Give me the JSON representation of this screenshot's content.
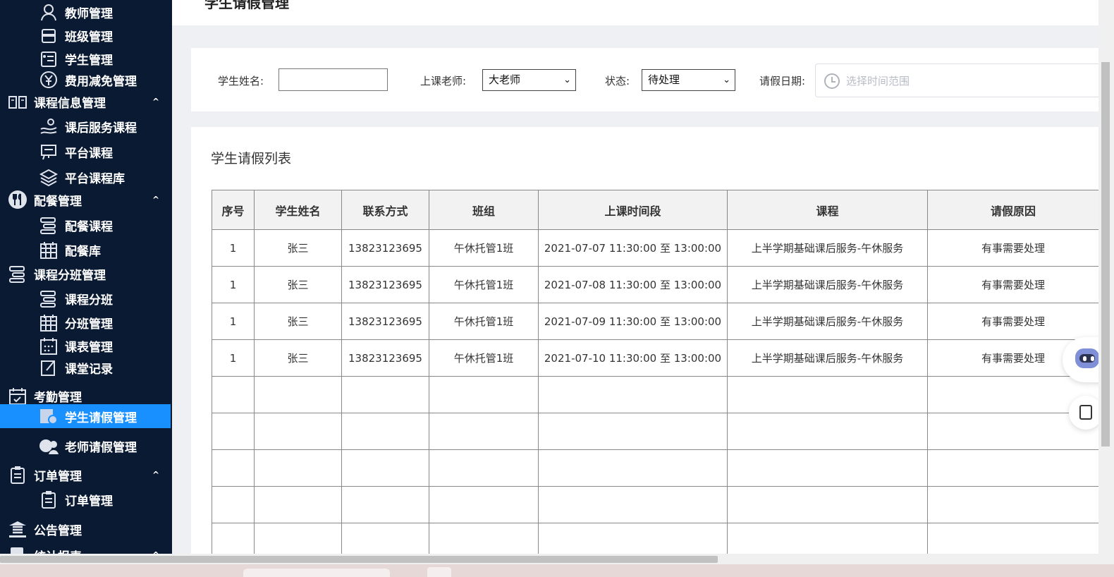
{
  "sidebar": {
    "items": [
      {
        "label": "教师管理",
        "icon": "teacher-icon",
        "level": 2
      },
      {
        "label": "班级管理",
        "icon": "class-icon",
        "level": 2
      },
      {
        "label": "学生管理",
        "icon": "student-card-icon",
        "level": 2
      },
      {
        "label": "费用减免管理",
        "icon": "yen-icon",
        "level": 2
      },
      {
        "label": "课程信息管理",
        "icon": "book-icon",
        "level": 1,
        "expanded": true
      },
      {
        "label": "课后服务课程",
        "icon": "service-icon",
        "level": 2
      },
      {
        "label": "平台课程",
        "icon": "presentation-icon",
        "level": 2
      },
      {
        "label": "平台课程库",
        "icon": "layers-icon",
        "level": 2
      },
      {
        "label": "配餐管理",
        "icon": "fork-knife-icon",
        "level": 1,
        "expanded": true
      },
      {
        "label": "配餐课程",
        "icon": "structure-icon",
        "level": 2
      },
      {
        "label": "配餐库",
        "icon": "calendar-grid-icon",
        "level": 2
      },
      {
        "label": "课程分班管理",
        "icon": "structure-icon",
        "level": 1
      },
      {
        "label": "课程分班",
        "icon": "structure-icon",
        "level": 2
      },
      {
        "label": "分班管理",
        "icon": "calendar-grid-icon",
        "level": 2
      },
      {
        "label": "课表管理",
        "icon": "calendar-icon",
        "level": 2
      },
      {
        "label": "课堂记录",
        "icon": "record-icon",
        "level": 2
      },
      {
        "label": "考勤管理",
        "icon": "calendar-check-icon",
        "level": 1
      },
      {
        "label": "学生请假管理",
        "icon": "student-leave-icon",
        "level": 2,
        "active": true
      },
      {
        "label": "老师请假管理",
        "icon": "teacher-leave-icon",
        "level": 2
      },
      {
        "label": "订单管理",
        "icon": "clipboard-icon",
        "level": 1,
        "expanded": true
      },
      {
        "label": "订单管理",
        "icon": "clipboard-icon",
        "level": 2
      },
      {
        "label": "公告管理",
        "icon": "bank-icon",
        "level": 1
      },
      {
        "label": "统计报表",
        "icon": "chart-icon",
        "level": 1,
        "expanded": true
      }
    ],
    "chevron": "^",
    "active_color": "#1890ff",
    "bg_color": "#0b1a33"
  },
  "page": {
    "title": "学生请假管理"
  },
  "filters": {
    "student_name_label": "学生姓名:",
    "student_name_value": "",
    "teacher_label": "上课老师:",
    "teacher_value": "大老师",
    "status_label": "状态:",
    "status_value": "待处理",
    "date_label": "请假日期:",
    "date_placeholder": "选择时间范围"
  },
  "list": {
    "title": "学生请假列表",
    "columns": [
      "序号",
      "学生姓名",
      "联系方式",
      "班组",
      "上课时间段",
      "课程",
      "请假原因"
    ],
    "rows": [
      [
        "1",
        "张三",
        "13823123695",
        "午休托管1班",
        "2021-07-07 11:30:00 至 13:00:00",
        "上半学期基础课后服务-午休服务",
        "有事需要处理"
      ],
      [
        "1",
        "张三",
        "13823123695",
        "午休托管1班",
        "2021-07-08 11:30:00 至 13:00:00",
        "上半学期基础课后服务-午休服务",
        "有事需要处理"
      ],
      [
        "1",
        "张三",
        "13823123695",
        "午休托管1班",
        "2021-07-09 11:30:00 至 13:00:00",
        "上半学期基础课后服务-午休服务",
        "有事需要处理"
      ],
      [
        "1",
        "张三",
        "13823123695",
        "午休托管1班",
        "2021-07-10 11:30:00 至 13:00:00",
        "上半学期基础课后服务-午休服务",
        "有事需要处理"
      ]
    ],
    "empty_rows": 5
  },
  "widgets": {
    "assistant_icon": "robot-icon",
    "notes_icon": "notes-icon"
  }
}
